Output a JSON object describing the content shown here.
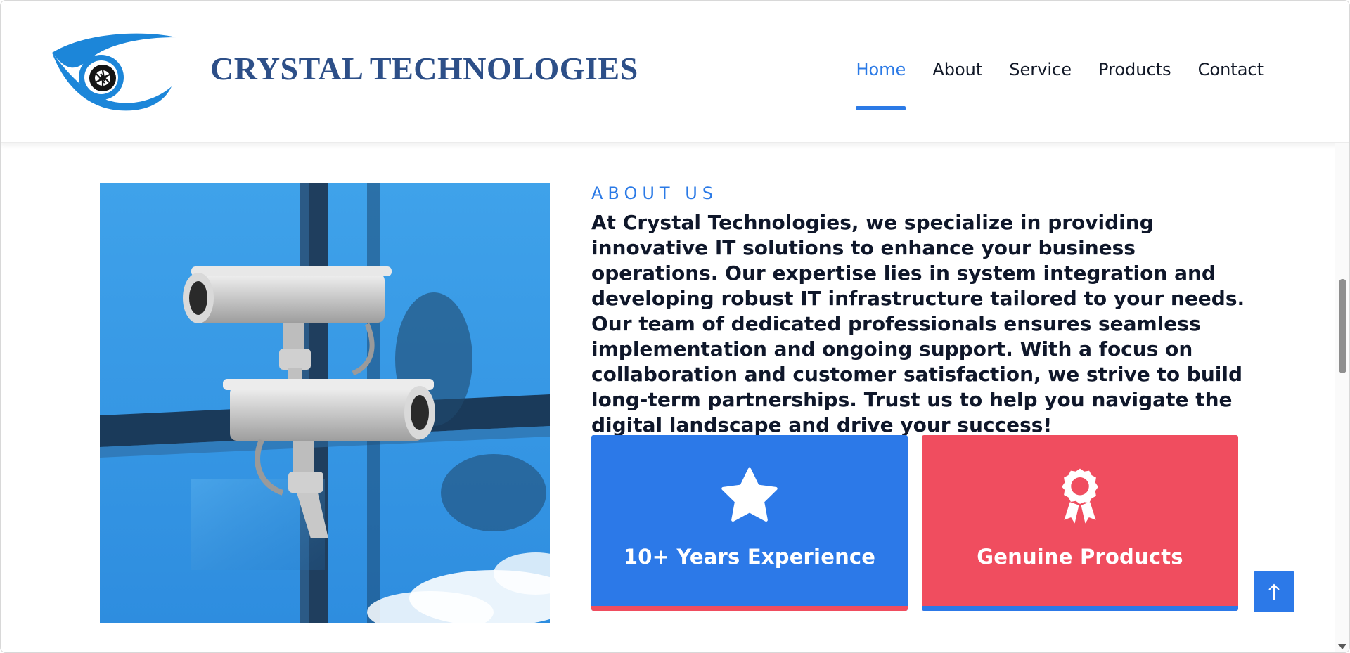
{
  "header": {
    "brand_name": "CRYSTAL TECHNOLOGIES",
    "logo_icon": "eye-camera-logo-icon",
    "nav": [
      {
        "label": "Home",
        "active": true
      },
      {
        "label": "About",
        "active": false
      },
      {
        "label": "Service",
        "active": false
      },
      {
        "label": "Products",
        "active": false
      },
      {
        "label": "Contact",
        "active": false
      }
    ]
  },
  "about": {
    "kicker": "ABOUT US",
    "body": "At Crystal Technologies, we specialize in providing innovative IT solutions to enhance your business operations. Our expertise lies in system integration and developing robust IT infrastructure tailored to your needs. Our team of dedicated professionals ensures seamless implementation and ongoing support. With a focus on collaboration and customer satisfaction, we strive to build long-term partnerships. Trust us to help you navigate the digital landscape and drive your success!",
    "cards": [
      {
        "label": "10+ Years Experience",
        "icon": "star-icon",
        "color": "#2c79e8"
      },
      {
        "label": "Genuine Products",
        "icon": "award-icon",
        "color": "#f04d5f"
      }
    ]
  },
  "colors": {
    "accent_blue": "#2b7ae6",
    "accent_red": "#f04d5f",
    "brand_navy": "#2d4f88",
    "text_dark": "#0f172a"
  },
  "icons": {
    "back_to_top": "arrow-up-icon",
    "hero_image": "cctv-cameras-photo"
  }
}
